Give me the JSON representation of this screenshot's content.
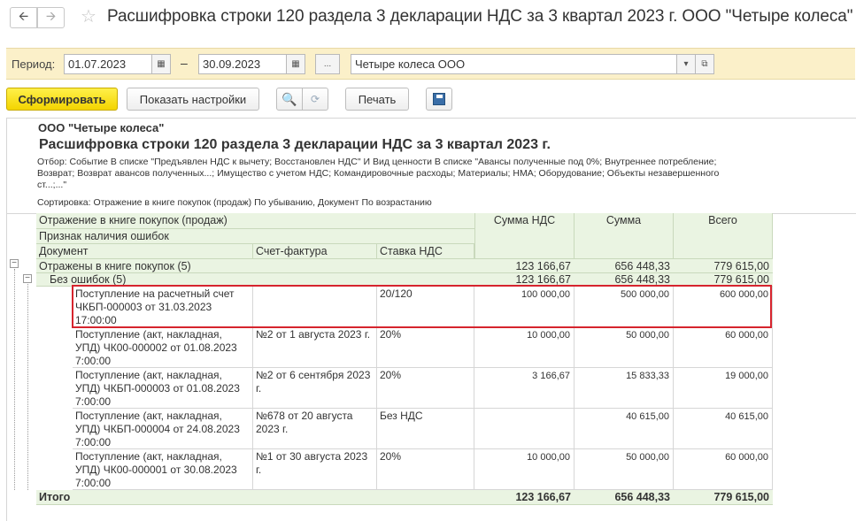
{
  "window": {
    "title": "Расшифровка строки 120 раздела 3 декларации НДС за 3 квартал 2023 г. ООО \"Четыре колеса\""
  },
  "period": {
    "label": "Период:",
    "from": "01.07.2023",
    "dash": "–",
    "to": "30.09.2023",
    "more": "...",
    "organization": "Четыре колеса ООО"
  },
  "toolbar": {
    "generate": "Сформировать",
    "show_settings": "Показать настройки",
    "print": "Печать"
  },
  "report": {
    "org": "ООО \"Четыре колеса\"",
    "title": "Расшифровка строки 120 раздела 3 декларации НДС за 3 квартал 2023 г.",
    "filter": "Отбор: Событие В списке \"Предъявлен НДС к вычету; Восстановлен НДС\" И Вид ценности В списке \"Авансы полученные под 0%; Внутреннее потребление; Возврат; Возврат авансов полученных...; Имущество с учетом НДС; Командировочные расходы; Материалы; НМА; Оборудование; Объекты незавершенного ст...;...\"",
    "sort": "Сортировка: Отражение в книге покупок (продаж) По убыванию, Документ По возрастанию"
  },
  "table": {
    "headers": {
      "group1": "Отражение в книге покупок (продаж)",
      "group2": "Признак наличия ошибок",
      "document": "Документ",
      "invoice": "Счет-фактура",
      "rate": "Ставка НДС",
      "vat_sum": "Сумма НДС",
      "sum": "Сумма",
      "total": "Всего"
    },
    "level1": {
      "label": "Отражены в книге покупок (5)",
      "vat": "123 166,67",
      "sum": "656 448,33",
      "total": "779 615,00"
    },
    "level2": {
      "label": "Без ошибок (5)",
      "vat": "123 166,67",
      "sum": "656 448,33",
      "total": "779 615,00"
    },
    "rows": [
      {
        "document": "Поступление на расчетный счет ЧКБП-000003 от 31.03.2023 17:00:00",
        "invoice": "",
        "rate": "20/120",
        "vat": "100 000,00",
        "sum": "500 000,00",
        "total": "600 000,00"
      },
      {
        "document": "Поступление (акт, накладная, УПД) ЧК00-000002 от 01.08.2023 7:00:00",
        "invoice": "№2 от 1 августа 2023 г.",
        "rate": "20%",
        "vat": "10 000,00",
        "sum": "50 000,00",
        "total": "60 000,00"
      },
      {
        "document": "Поступление (акт, накладная, УПД) ЧКБП-000003 от 01.08.2023 7:00:00",
        "invoice": "№2 от 6 сентября 2023 г.",
        "rate": "20%",
        "vat": "3 166,67",
        "sum": "15 833,33",
        "total": "19 000,00"
      },
      {
        "document": "Поступление (акт, накладная, УПД) ЧКБП-000004 от 24.08.2023 7:00:00",
        "invoice": "№678 от 20 августа 2023 г.",
        "rate": "Без НДС",
        "vat": "",
        "sum": "40 615,00",
        "total": "40 615,00"
      },
      {
        "document": "Поступление (акт, накладная, УПД) ЧК00-000001 от 30.08.2023 7:00:00",
        "invoice": "№1 от 30 августа 2023 г.",
        "rate": "20%",
        "vat": "10 000,00",
        "sum": "50 000,00",
        "total": "60 000,00"
      }
    ],
    "totals": {
      "label": "Итого",
      "vat": "123 166,67",
      "sum": "656 448,33",
      "total": "779 615,00"
    }
  },
  "colors": {
    "period_bar": "#fbf0c9",
    "primary_button": "#f3d400",
    "table_header": "#eaf4e2",
    "highlight": "#d6242e"
  }
}
